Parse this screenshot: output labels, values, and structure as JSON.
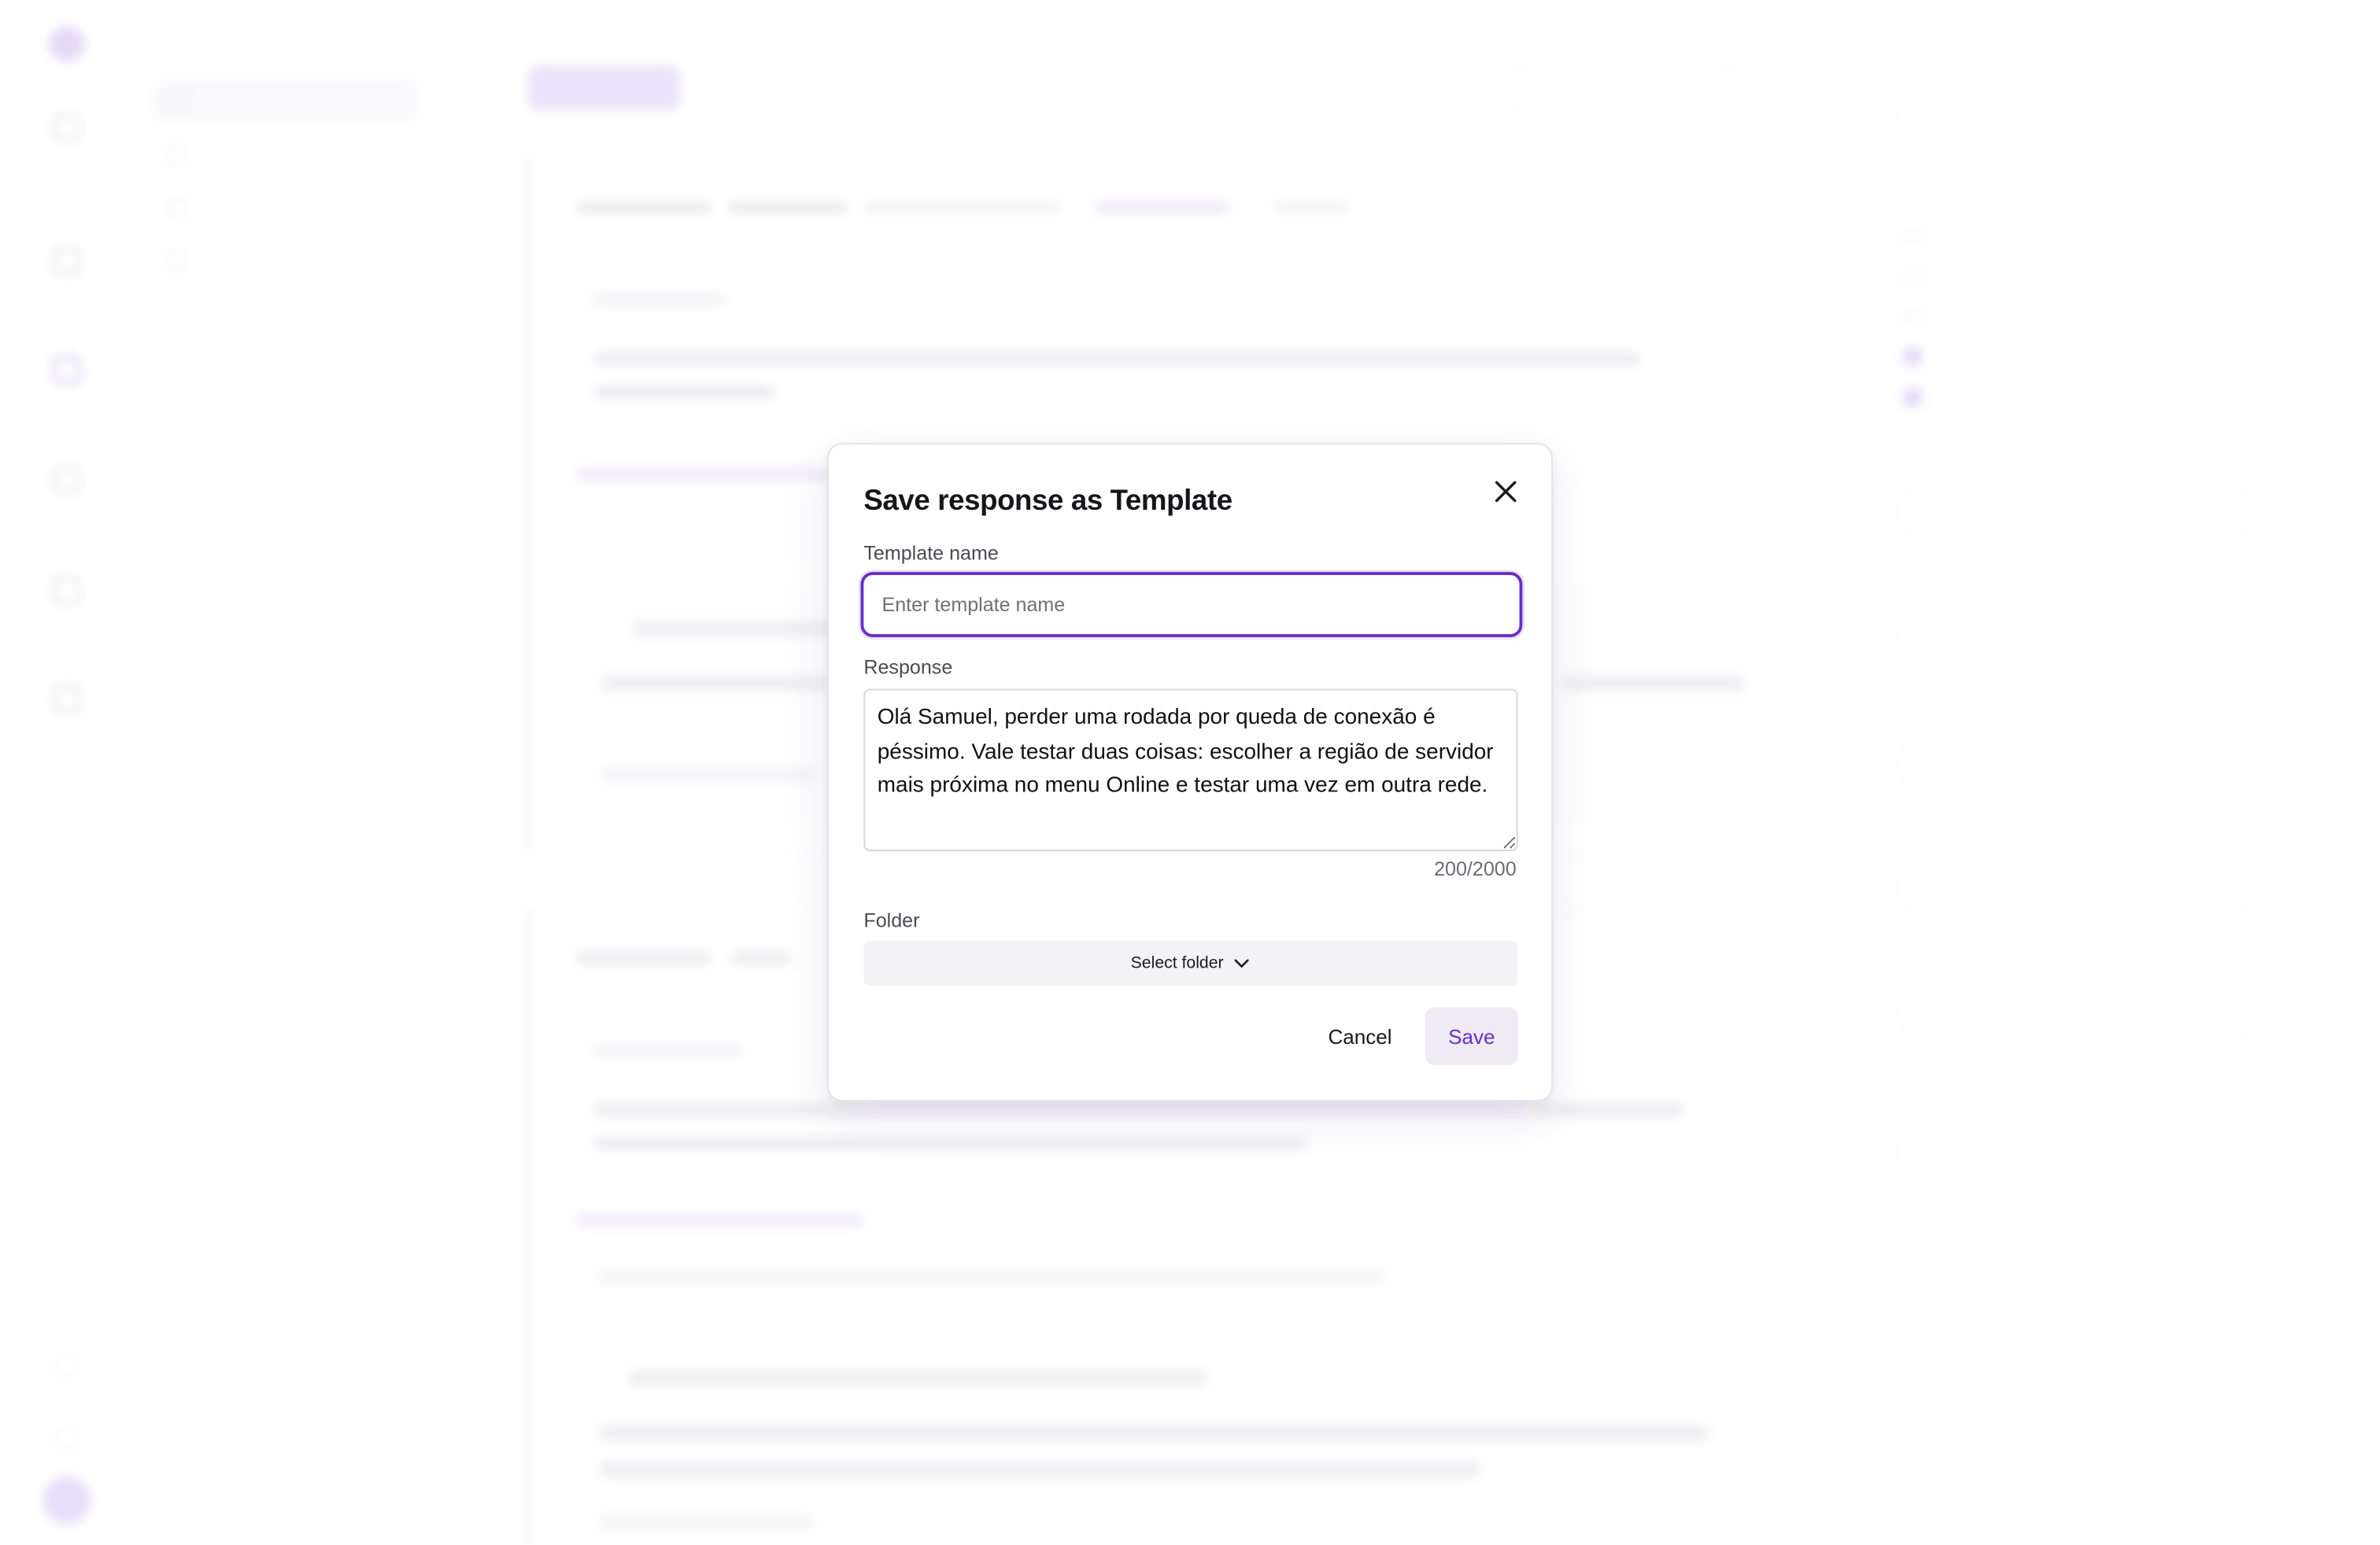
{
  "modal": {
    "title": "Save response as Template",
    "template_name_label": "Template name",
    "template_name_placeholder": "Enter template name",
    "template_name_value": "",
    "response_label": "Response",
    "response_value": "Olá Samuel, perder uma rodada por queda de conexão é péssimo. Vale testar duas coisas: escolher a região de servidor mais próxima no menu Online e testar uma vez em outra rede.",
    "char_count": "200/2000",
    "folder_label": "Folder",
    "folder_select_label": "Select folder",
    "cancel_label": "Cancel",
    "save_label": "Save",
    "icons": {
      "close": "close-icon",
      "folder_dropdown": "chevron-down-icon"
    },
    "colors": {
      "accent": "#6a2fc9",
      "save_button_bg": "#efeaf3",
      "folder_select_bg": "#f3f3f5"
    }
  }
}
